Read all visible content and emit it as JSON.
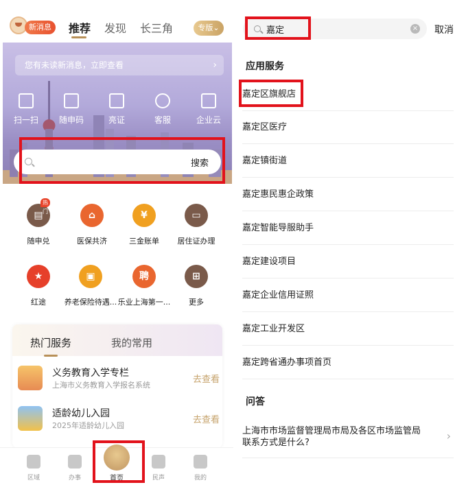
{
  "left": {
    "header": {
      "new_message_badge": "新消息",
      "tabs": [
        "推荐",
        "发现",
        "长三角"
      ],
      "active_tab": "推荐",
      "pro_button": "专版⌄"
    },
    "notice": "您有未读新消息，立即查看",
    "quick_actions": [
      "扫一扫",
      "随申码",
      "亮证",
      "客服",
      "企业云"
    ],
    "search": {
      "button": "搜索"
    },
    "service_grid": [
      {
        "label": "随申兑",
        "badge": "热门",
        "color": "#7a5a4a"
      },
      {
        "label": "医保共济",
        "color": "#e9662f"
      },
      {
        "label": "三金账单",
        "color": "#f0a020"
      },
      {
        "label": "居住证办理",
        "color": "#7a5a4a"
      },
      {
        "label": "红途",
        "color": "#e6402a"
      },
      {
        "label": "养老保险待遇...",
        "color": "#f0a020"
      },
      {
        "label": "乐业上海第一...",
        "color": "#e9662f"
      },
      {
        "label": "更多",
        "color": "#7a5a4a"
      }
    ],
    "hot_card": {
      "tabs": [
        "热门服务",
        "我的常用"
      ],
      "items": [
        {
          "title": "义务教育入学专栏",
          "subtitle": "上海市义务教育入学报名系统",
          "action": "去查看"
        },
        {
          "title": "适龄幼儿入园",
          "subtitle": "2025年适龄幼儿入园",
          "action": "去查看"
        }
      ]
    },
    "bottom_nav": [
      "区域",
      "办事",
      "首页",
      "民声",
      "我的"
    ]
  },
  "right": {
    "search_value": "嘉定",
    "cancel": "取消",
    "section_apps": "应用服务",
    "results": [
      "嘉定区旗舰店",
      "嘉定区医疗",
      "嘉定镇街道",
      "嘉定惠民惠企政策",
      "嘉定智能导服助手",
      "嘉定建设项目",
      "嘉定企业信用证照",
      "嘉定工业开发区",
      "嘉定跨省通办事项首页"
    ],
    "section_qa": "问答",
    "qa_item": "上海市市场监督管理局市局及各区市场监管局联系方式是什么?"
  },
  "colors": {
    "accent_gold": "#b89058",
    "highlight_red": "#e2121b"
  }
}
